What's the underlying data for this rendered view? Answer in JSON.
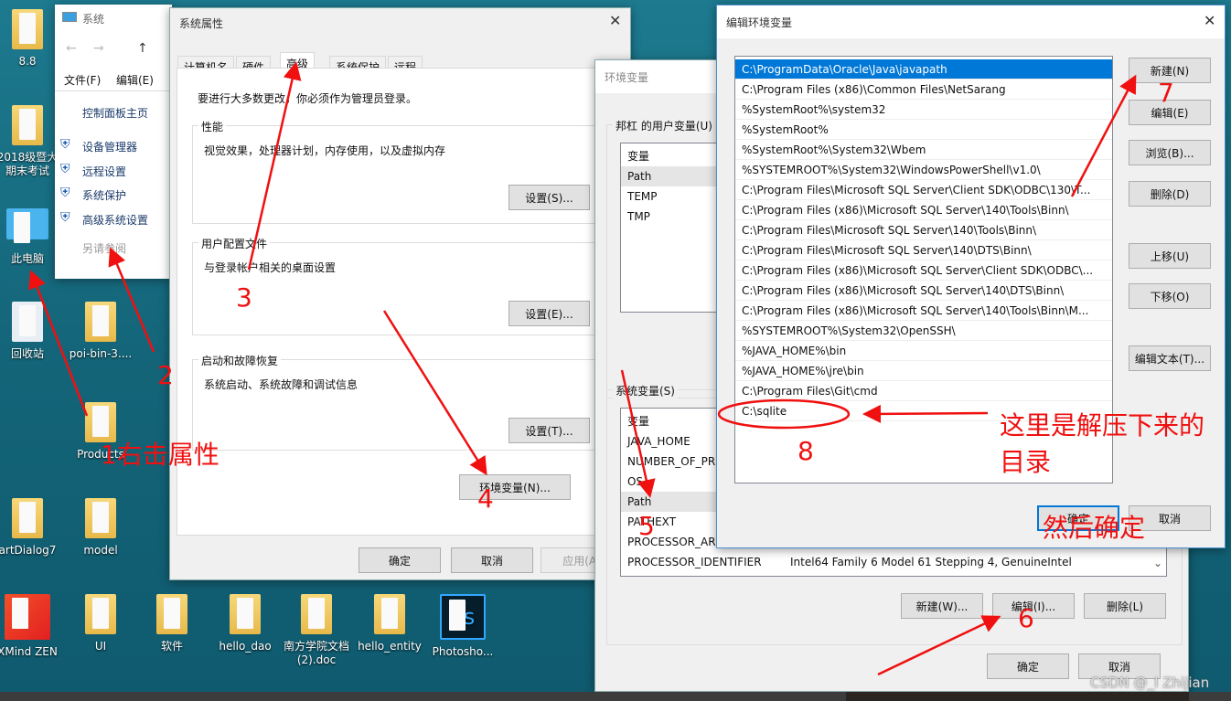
{
  "desktop": {
    "icons": [
      "8.8",
      "2018级暨大期末考试",
      "此电脑",
      "回收站",
      "poi-bin-3....",
      "Products",
      "artDialog7",
      "model",
      "XMind ZEN",
      "UI",
      "软件",
      "hello_dao",
      "南方学院文档(2).doc",
      "hello_entity",
      "Photosho..."
    ]
  },
  "explorer": {
    "title": "系统",
    "menu": [
      "文件(F)",
      "编辑(E)"
    ],
    "control_panel_home": "控制面板主页",
    "links": [
      "设备管理器",
      "远程设置",
      "系统保护",
      "高级系统设置"
    ],
    "see_also": "另请参阅"
  },
  "sysprops": {
    "title": "系统属性",
    "tabs": [
      "计算机名",
      "硬件",
      "高级",
      "系统保护",
      "远程"
    ],
    "active_tab": "高级",
    "admin_note": "要进行大多数更改，你必须作为管理员登录。",
    "perf": {
      "label": "性能",
      "desc": "视觉效果，处理器计划，内存使用，以及虚拟内存",
      "button": "设置(S)..."
    },
    "profile": {
      "label": "用户配置文件",
      "desc": "与登录帐户相关的桌面设置",
      "button": "设置(E)..."
    },
    "startup": {
      "label": "启动和故障恢复",
      "desc": "系统启动、系统故障和调试信息",
      "button": "设置(T)..."
    },
    "env_button": "环境变量(N)...",
    "ok": "确定",
    "cancel": "取消",
    "apply": "应用(A)"
  },
  "envvars": {
    "title": "环境变量",
    "user_label": "邦杠 的用户变量(U)",
    "user_header": "变量",
    "user_vars": [
      "Path",
      "TEMP",
      "TMP"
    ],
    "user_selected": "Path",
    "sys_label": "系统变量(S)",
    "sys_header": "变量",
    "sys_vars": [
      "JAVA_HOME",
      "NUMBER_OF_PR",
      "OS",
      "Path",
      "PATHEXT",
      "PROCESSOR_AR",
      "PROCESSOR_IDENTIFIER"
    ],
    "sys_selected": "Path",
    "processor_identifier_value": "Intel64 Family 6 Model 61 Stepping 4, GenuineIntel",
    "new": "新建(W)...",
    "edit": "编辑(I)...",
    "delete": "删除(L)",
    "ok": "确定",
    "cancel": "取消"
  },
  "editenv": {
    "title": "编辑环境变量",
    "entries": [
      "C:\\ProgramData\\Oracle\\Java\\javapath",
      "C:\\Program Files (x86)\\Common Files\\NetSarang",
      "%SystemRoot%\\system32",
      "%SystemRoot%",
      "%SystemRoot%\\System32\\Wbem",
      "%SYSTEMROOT%\\System32\\WindowsPowerShell\\v1.0\\",
      "C:\\Program Files\\Microsoft SQL Server\\Client SDK\\ODBC\\130\\T...",
      "C:\\Program Files (x86)\\Microsoft SQL Server\\140\\Tools\\Binn\\",
      "C:\\Program Files\\Microsoft SQL Server\\140\\Tools\\Binn\\",
      "C:\\Program Files\\Microsoft SQL Server\\140\\DTS\\Binn\\",
      "C:\\Program Files (x86)\\Microsoft SQL Server\\Client SDK\\ODBC\\...",
      "C:\\Program Files (x86)\\Microsoft SQL Server\\140\\DTS\\Binn\\",
      "C:\\Program Files (x86)\\Microsoft SQL Server\\140\\Tools\\Binn\\M...",
      "%SYSTEMROOT%\\System32\\OpenSSH\\",
      "%JAVA_HOME%\\bin",
      "%JAVA_HOME%\\jre\\bin",
      "C:\\Program Files\\Git\\cmd",
      "C:\\sqlite"
    ],
    "selected_index": 0,
    "buttons": [
      "新建(N)",
      "编辑(E)",
      "浏览(B)...",
      "删除(D)",
      "上移(U)",
      "下移(O)",
      "编辑文本(T)..."
    ],
    "ok": "确定",
    "cancel": "取消"
  },
  "annotations": {
    "s1": "1右击属性",
    "s2": "2",
    "s3": "3",
    "s4": "4",
    "s5": "5",
    "s6": "6",
    "s7": "7",
    "s8": "8",
    "unzip_dir": "这里是解压下来的",
    "unzip_dir2": "目录",
    "then_ok": "然后确定",
    "color": "#f01010"
  },
  "watermark": "CSDN @_I Zhijian",
  "colors": {
    "desktop": "#146579",
    "selection": "#0078d7",
    "dialog": "#f0f0f0"
  }
}
